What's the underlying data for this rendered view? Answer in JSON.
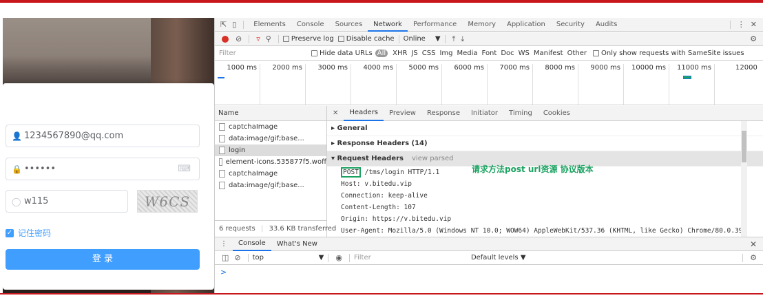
{
  "login": {
    "email": "1234567890@qq.com",
    "password_mask": "••••••",
    "captcha_value": "w115",
    "captcha_text": "W6CS",
    "remember_label": "记住密码",
    "login_button": "登 录"
  },
  "devtools": {
    "tabs": [
      "Elements",
      "Console",
      "Sources",
      "Network",
      "Performance",
      "Memory",
      "Application",
      "Security",
      "Audits"
    ],
    "active_tab": "Network",
    "toolbar": {
      "preserve_log": "Preserve log",
      "disable_cache": "Disable cache",
      "throttle": "Online"
    },
    "filter": {
      "placeholder": "Filter",
      "hide_data_urls": "Hide data URLs",
      "all": "All",
      "types": [
        "XHR",
        "JS",
        "CSS",
        "Img",
        "Media",
        "Font",
        "Doc",
        "WS",
        "Manifest",
        "Other"
      ],
      "samesite": "Only show requests with SameSite issues"
    },
    "timeline_ticks": [
      "1000 ms",
      "2000 ms",
      "3000 ms",
      "4000 ms",
      "5000 ms",
      "6000 ms",
      "7000 ms",
      "8000 ms",
      "9000 ms",
      "10000 ms",
      "11000 ms",
      "12000"
    ],
    "requests_header": "Name",
    "requests": [
      {
        "name": "captchaImage",
        "selected": false
      },
      {
        "name": "data:image/gif;base...",
        "selected": false
      },
      {
        "name": "login",
        "selected": true
      },
      {
        "name": "element-icons.535877f5.woff",
        "selected": false
      },
      {
        "name": "captchaImage",
        "selected": false
      },
      {
        "name": "data:image/gif;base...",
        "selected": false
      }
    ],
    "summary": {
      "requests": "6 requests",
      "transferred": "33.6 KB transferred"
    },
    "detail_tabs": [
      "Headers",
      "Preview",
      "Response",
      "Initiator",
      "Timing",
      "Cookies"
    ],
    "active_detail_tab": "Headers",
    "sections": {
      "general": "General",
      "response_headers": "Response Headers (14)",
      "request_headers": "Request Headers",
      "view_parsed": "view parsed"
    },
    "request_lines": {
      "method": "POST",
      "first_line_rest": " /tms/login HTTP/1.1",
      "lines": [
        "Host: v.bitedu.vip",
        "Connection: keep-alive",
        "Content-Length: 107",
        "Origin: https://v.bitedu.vip",
        "User-Agent: Mozilla/5.0 (Windows NT 10.0; WOW64) AppleWebKit/537.36 (KHTML, like Gecko) Chrome/80.0.39"
      ]
    },
    "annotation": "请求方法post url资源 协议版本",
    "drawer": {
      "tabs": [
        "Console",
        "What's New"
      ],
      "context": "top",
      "filter_placeholder": "Filter",
      "levels": "Default levels ▼",
      "prompt": ">"
    }
  },
  "colors": {
    "accent": "#409eff",
    "annotation": "#1aa260",
    "frame_red": "#c9171e"
  }
}
